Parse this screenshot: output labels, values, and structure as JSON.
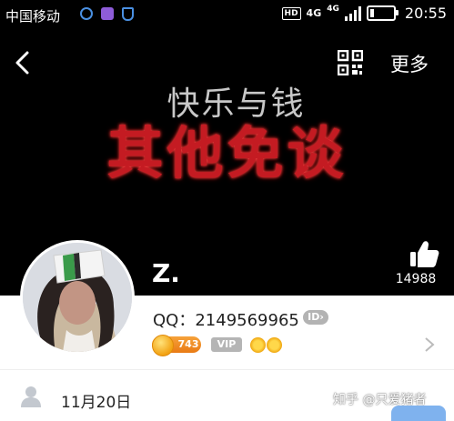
{
  "status_bar": {
    "carrier": "中国移动",
    "hd": "HD",
    "network": "4G",
    "network_small": "4G",
    "time": "20:55"
  },
  "nav": {
    "back_icon": "chevron-left-icon",
    "qr_icon": "qr-code-icon",
    "more_label": "更多"
  },
  "cover": {
    "line1": "快乐与钱",
    "line2": "其他免谈",
    "colors": {
      "line1": "#c8c8c8",
      "line2": "#c41b22"
    }
  },
  "likes": {
    "icon": "thumbs-up-icon",
    "count": "14988"
  },
  "profile": {
    "name": "Z.",
    "qq_label": "QQ：",
    "qq_number": "2149569965",
    "id_badge": "ID",
    "level_badge": "743",
    "vip_label": "VIP"
  },
  "info": {
    "birthday": "11月20日"
  },
  "watermark": "知乎 @只爱猪者"
}
